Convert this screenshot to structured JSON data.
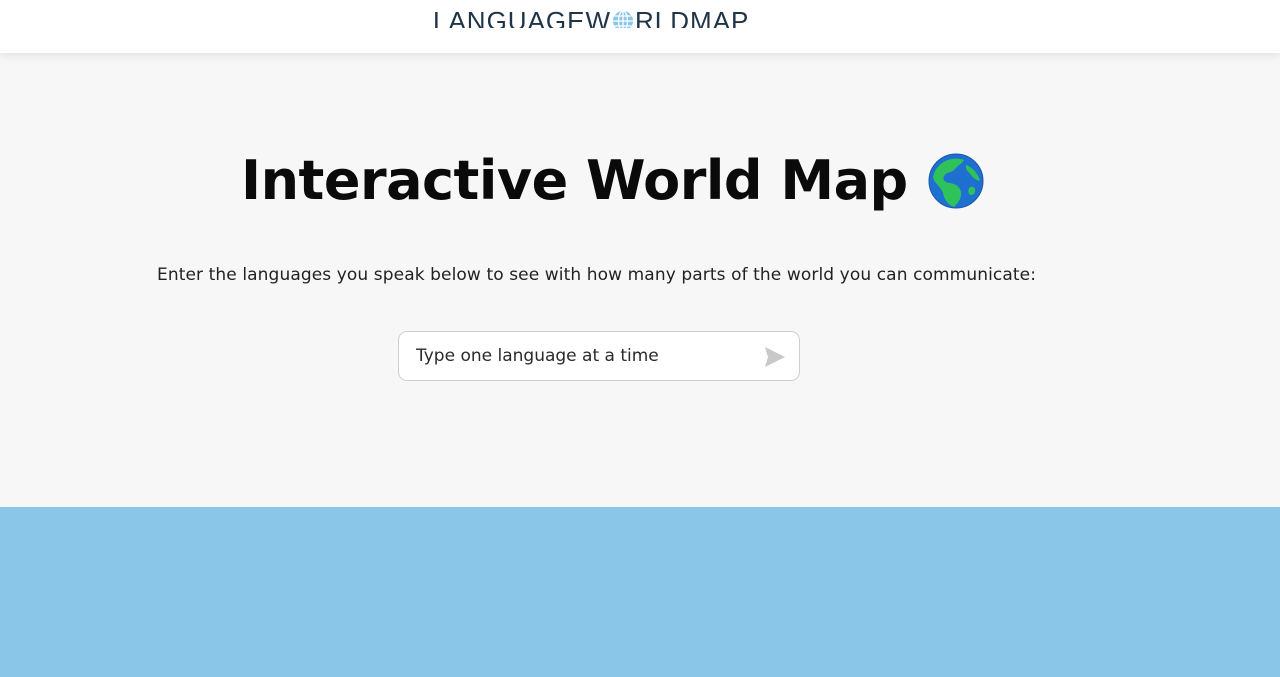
{
  "header": {
    "logo_left": "LANGUAGEW",
    "logo_right": "RLDMAP",
    "logo_globe_icon": "globe-grid-icon"
  },
  "hero": {
    "title": "Interactive World Map",
    "title_icon": "earth-africa-emoji",
    "subtitle": "Enter the languages you speak below to see with how many parts of the world you can communicate:"
  },
  "search": {
    "placeholder": "Type one language at a time",
    "value": "",
    "submit_icon": "send-icon"
  },
  "colors": {
    "logo": "#1f3447",
    "logo_globe": "#8ac6e7",
    "background": "#f7f7f7",
    "map_ocean": "#8ac6e7",
    "send_icon": "#c8c8c8"
  }
}
